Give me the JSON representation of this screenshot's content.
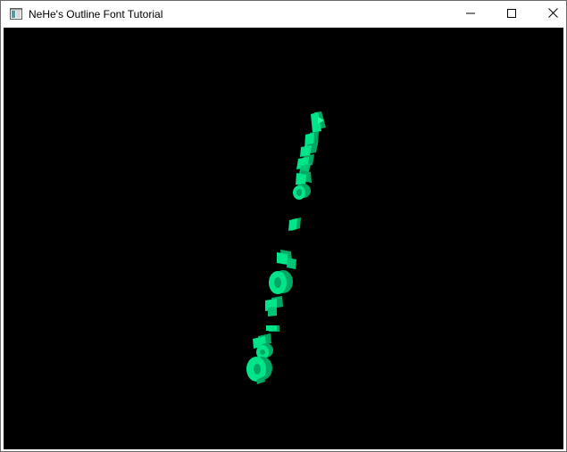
{
  "window": {
    "title": "NeHe's Outline Font Tutorial",
    "app_icon": "app-window-icon",
    "controls": {
      "minimize_icon": "minimize-icon",
      "maximize_icon": "maximize-icon",
      "close_icon": "close-icon"
    }
  },
  "scene": {
    "background_color": "#000000",
    "glyph_color": "#00e58a",
    "glyph_shade_color": "#00a865",
    "glyph_highlight_color": "#2bff9f",
    "description_of_content": ""
  }
}
